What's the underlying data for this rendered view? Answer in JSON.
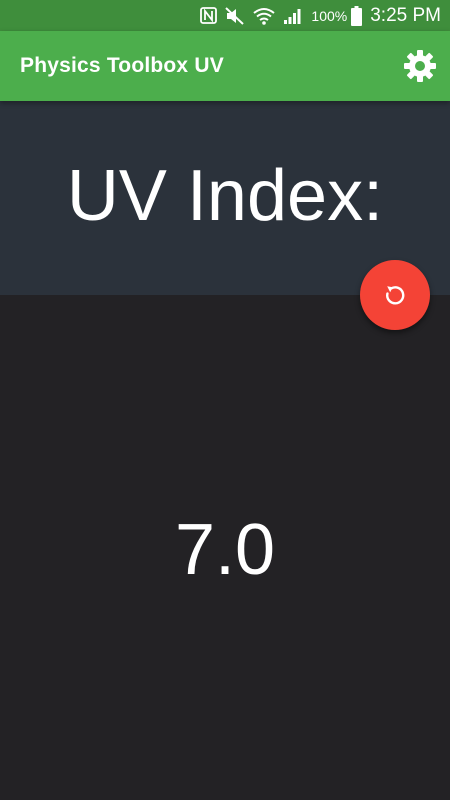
{
  "status_bar": {
    "icons": [
      "nfc-icon",
      "mute-icon",
      "wifi-icon",
      "signal-icon",
      "battery-icon"
    ],
    "battery_percent": "100%",
    "time": "3:25 PM"
  },
  "app_bar": {
    "title": "Physics Toolbox UV",
    "settings_icon": "gear-icon"
  },
  "main": {
    "heading": "UV Index:",
    "value": "7.0",
    "reset_icon": "refresh-icon"
  },
  "colors": {
    "status_bar": "#3f8e3c",
    "app_bar": "#4cae4c",
    "header_panel": "#2b323b",
    "background": "#232225",
    "accent_fab": "#f44336"
  }
}
